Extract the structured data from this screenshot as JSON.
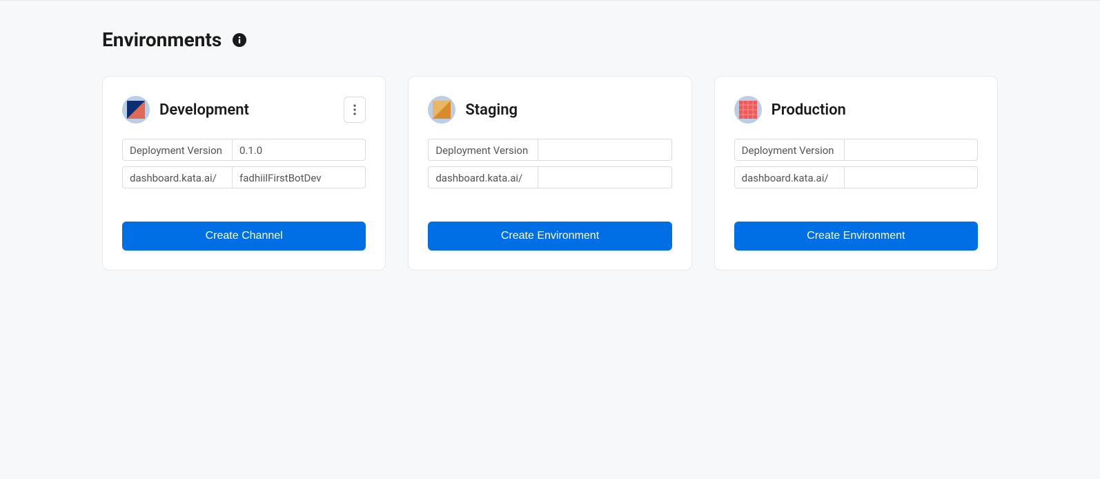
{
  "page": {
    "title": "Environments"
  },
  "environments": [
    {
      "title": "Development",
      "showMoreMenu": true,
      "fields": {
        "versionLabel": "Deployment Version",
        "versionValue": "0.1.0",
        "urlLabel": "dashboard.kata.ai/",
        "urlValue": "fadhiilFirstBotDev"
      },
      "buttonLabel": "Create Channel",
      "iconVariant": "dev"
    },
    {
      "title": "Staging",
      "showMoreMenu": false,
      "fields": {
        "versionLabel": "Deployment Version",
        "versionValue": "",
        "urlLabel": "dashboard.kata.ai/",
        "urlValue": ""
      },
      "buttonLabel": "Create Environment",
      "iconVariant": "staging"
    },
    {
      "title": "Production",
      "showMoreMenu": false,
      "fields": {
        "versionLabel": "Deployment Version",
        "versionValue": "",
        "urlLabel": "dashboard.kata.ai/",
        "urlValue": ""
      },
      "buttonLabel": "Create Environment",
      "iconVariant": "prod"
    }
  ]
}
